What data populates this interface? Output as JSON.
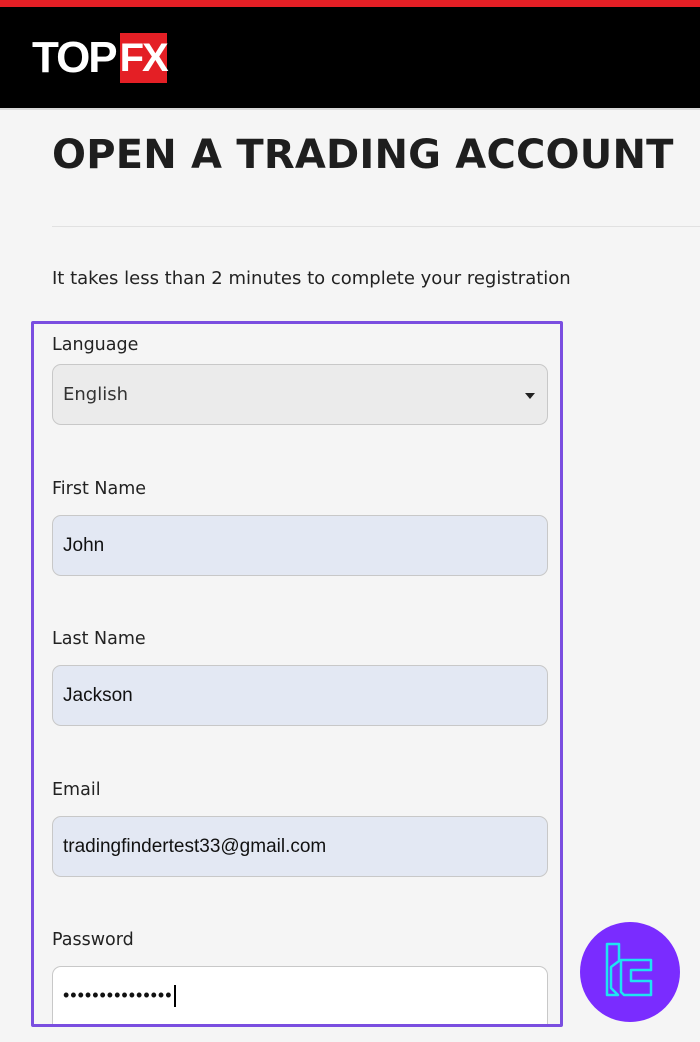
{
  "header": {
    "logo_part1": "TOP",
    "logo_part2": "FX",
    "accent_color": "#e41f25",
    "background_color": "#000000"
  },
  "page": {
    "title": "OPEN A TRADING ACCOUNT",
    "subtitle": "It takes less than 2 minutes to complete your registration"
  },
  "form": {
    "highlight_color": "#7a4ee0",
    "language": {
      "label": "Language",
      "value": "English",
      "icon": "caret-down-icon"
    },
    "first_name": {
      "label": "First Name",
      "value": "John"
    },
    "last_name": {
      "label": "Last Name",
      "value": "Jackson"
    },
    "email": {
      "label": "Email",
      "value": "tradingfindertest33@gmail.com"
    },
    "password": {
      "label": "Password",
      "value": "•••••••••••••••"
    }
  },
  "badge": {
    "icon": "brand-logo-icon",
    "color": "#7a2cff"
  }
}
